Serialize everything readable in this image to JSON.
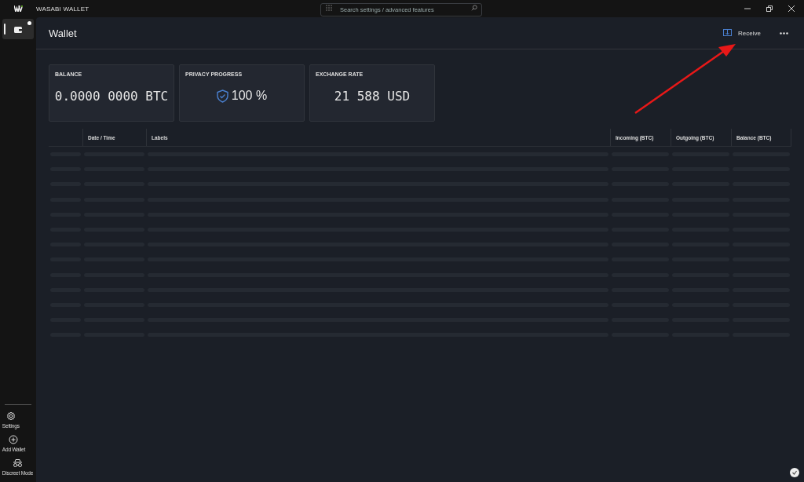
{
  "window": {
    "title": "WASABI WALLET"
  },
  "search": {
    "placeholder": "Search settings / advanced features"
  },
  "sidebar": {
    "wallets": [
      {
        "selected": true,
        "unread": true
      }
    ],
    "bottom_items": [
      {
        "kind": "settings",
        "label": "Settings"
      },
      {
        "kind": "add",
        "label": "Add Wallet"
      },
      {
        "kind": "discreet",
        "label": "Discreet Mode"
      }
    ]
  },
  "header": {
    "title": "Wallet",
    "receive_button": "Receive"
  },
  "tiles": [
    {
      "kind": "plain",
      "title": "BALANCE",
      "value": "0.0000 0000 BTC"
    },
    {
      "kind": "privacy",
      "title": "PRIVACY PROGRESS",
      "value": "100 %"
    },
    {
      "kind": "plain",
      "title": "EXCHANGE RATE",
      "value": "21 588 USD"
    }
  ],
  "table": {
    "columns": [
      "Date / Time",
      "Labels",
      "Incoming (BTC)",
      "Outgoing (BTC)",
      "Balance (BTC)"
    ],
    "loading": true
  }
}
